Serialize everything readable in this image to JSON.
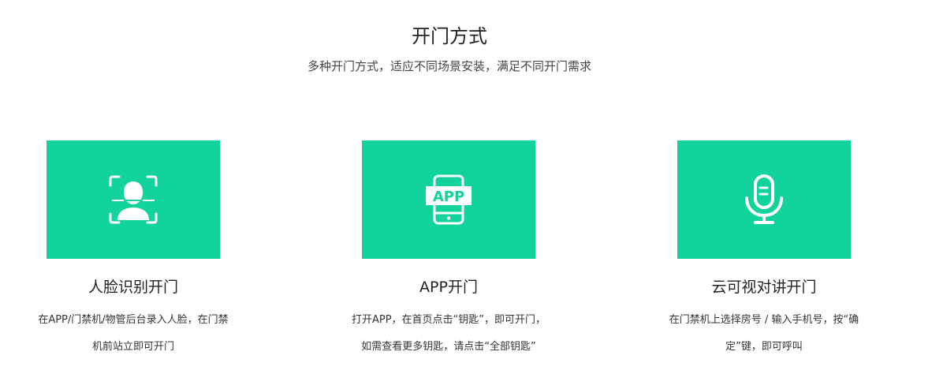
{
  "section": {
    "title": "开门方式",
    "subtitle": "多种开门方式，适应不同场景安装，满足不同开门需求"
  },
  "accent_color": "#12d39c",
  "cards": [
    {
      "icon": "face-recognition-icon",
      "title": "人脸识别开门",
      "desc_lines": [
        "在APP/门禁机/物管后台录入人脸，在门禁",
        "机前站立即可开门"
      ]
    },
    {
      "icon": "app-phone-icon",
      "icon_text": "APP",
      "title": "APP开门",
      "desc_lines": [
        "打开APP，在首页点击“钥匙”，即可开门，",
        "如需查看更多钥匙，请点击“全部钥匙”"
      ]
    },
    {
      "icon": "microphone-icon",
      "title": "云可视对讲开门",
      "desc_lines": [
        "在门禁机上选择房号 / 输入手机号，按“确",
        "定”键，即可呼叫"
      ]
    }
  ]
}
